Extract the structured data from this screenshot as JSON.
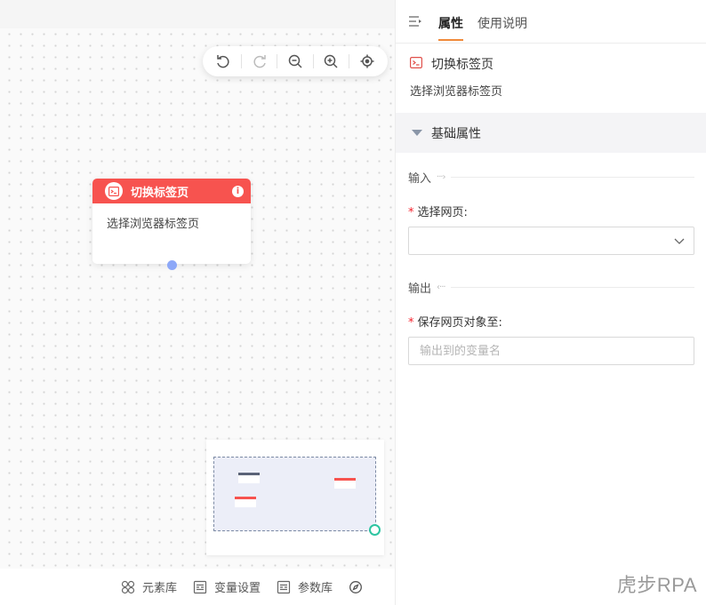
{
  "canvas": {
    "toolbar": {
      "undo_icon": "undo-icon",
      "redo_icon": "redo-icon",
      "zoom_out_icon": "zoom-out-icon",
      "zoom_in_icon": "zoom-in-icon",
      "locate_icon": "locate-icon"
    },
    "node": {
      "title": "切换标签页",
      "description": "选择浏览器标签页",
      "header_color": "#f7534f",
      "port_color": "#8da8f8"
    }
  },
  "bottombar": {
    "items": [
      {
        "label": "元素库",
        "icon": "grid-icon"
      },
      {
        "label": "变量设置",
        "icon": "variable-icon"
      },
      {
        "label": "参数库",
        "icon": "params-icon"
      },
      {
        "label": "",
        "icon": "compass-icon"
      }
    ]
  },
  "panel": {
    "tabs": {
      "properties": "属性",
      "help": "使用说明"
    },
    "component": {
      "title": "切换标签页",
      "description": "选择浏览器标签页"
    },
    "section": {
      "title": "基础属性"
    },
    "input_group": {
      "label": "输入",
      "fields": {
        "select_page_label": "选择网页:",
        "select_page_value": ""
      }
    },
    "output_group": {
      "label": "输出",
      "fields": {
        "save_obj_label": "保存网页对象至:",
        "save_obj_placeholder": "输出到的变量名",
        "save_obj_value": ""
      }
    },
    "accent_color": "#f08a3a",
    "required_color": "#f5222d"
  },
  "watermark": "虎步RPA"
}
